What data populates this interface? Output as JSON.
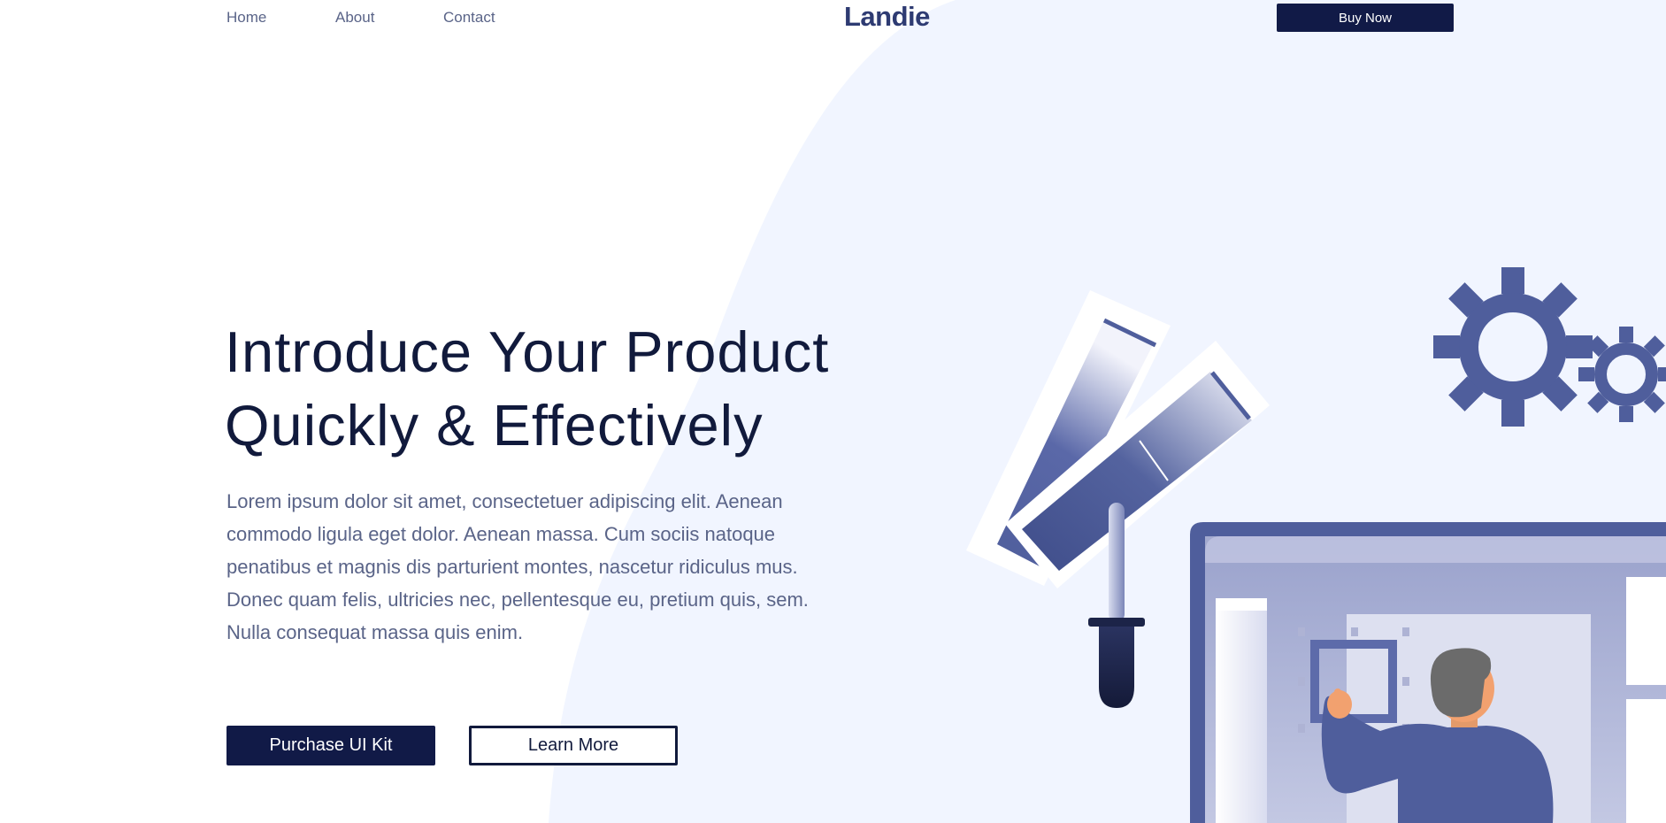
{
  "nav": {
    "links": [
      "Home",
      "About",
      "Contact"
    ],
    "logo": "Landie",
    "cta": "Buy Now"
  },
  "hero": {
    "title_lines": [
      "Introduce Your Product",
      "Quickly & Effectively"
    ],
    "body": "Lorem ipsum dolor sit amet, consectetuer adipiscing elit. Aenean commodo ligula eget dolor. Aenean massa. Cum sociis natoque penatibus et magnis dis parturient montes, nascetur ridiculus mus. Donec quam felis, ultricies nec, pellentesque eu, pretium quis, sem. Nulla consequat massa quis enim.",
    "primary_button": "Purchase UI Kit",
    "secondary_button": "Learn More"
  },
  "colors": {
    "brand_dark": "#111a47",
    "accent": "#4f5e9c",
    "background_blob": "#f1f5ff",
    "text_muted": "#5a6488"
  },
  "illustration": {
    "icons": [
      "large-gear-icon",
      "small-gear-icon",
      "color-swatch-icon",
      "dropper-icon",
      "monitor-icon",
      "designer-figure"
    ]
  }
}
